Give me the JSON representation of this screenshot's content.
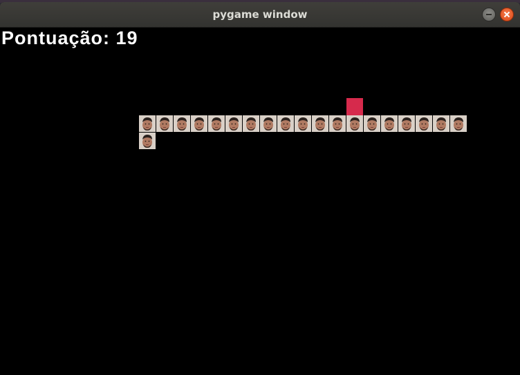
{
  "window": {
    "title": "pygame window",
    "buttons": [
      "minimize",
      "close"
    ]
  },
  "game": {
    "score_label": "Pontuação:",
    "score_value": "19",
    "background_color": "#000000",
    "food_color": "#d62a4c",
    "snake_length": 20,
    "snake_segment_icon": "face-photo-icon"
  }
}
